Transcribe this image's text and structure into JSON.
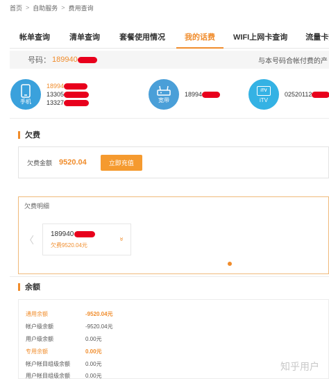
{
  "breadcrumb": {
    "home": "首页",
    "sep": ">",
    "self_service": "自助服务",
    "current": "费用查询"
  },
  "tabs": [
    "帐单查询",
    "清单查询",
    "套餐使用情况",
    "我的话费",
    "WIFI上网卡查询",
    "流量卡查询"
  ],
  "active_tab": "我的话费",
  "number_bar": {
    "label": "号码：",
    "number": "189940",
    "note": "与本号码合帐付费的产"
  },
  "services": {
    "phone": {
      "label": "手机",
      "lines": [
        "18994",
        "13305",
        "13327"
      ]
    },
    "broadband": {
      "label": "宽带",
      "line": "18994"
    },
    "itv": {
      "label": "iTV",
      "logo": "iTV",
      "line": "02520112"
    }
  },
  "arrears": {
    "title": "欠费",
    "balance_label": "欠费金额",
    "balance_value": "9520.04",
    "pay_button": "立即充值"
  },
  "arrears_detail": {
    "title": "欠费明细",
    "card_number": "189940",
    "card_desc": "欠费9520.04元",
    "prev_arrow": "〈",
    "expand_icon": "»"
  },
  "balance": {
    "title": "余额",
    "rows": [
      {
        "k": "通用余额",
        "v": "-9520.04元"
      },
      {
        "k": "帐户级余额",
        "v": "-9520.04元"
      },
      {
        "k": "用户级余额",
        "v": "0.00元"
      },
      {
        "k": "专用余额",
        "v": "0.00元"
      },
      {
        "k": "帐户帐目组级余额",
        "v": "0.00元"
      },
      {
        "k": "用户帐目组级余额",
        "v": "0.00元"
      }
    ]
  },
  "watermark": "知乎用户",
  "colors": {
    "accent": "#f08c2b",
    "redaction": "#e8001c",
    "icon_blue": "#3aa1dc"
  }
}
